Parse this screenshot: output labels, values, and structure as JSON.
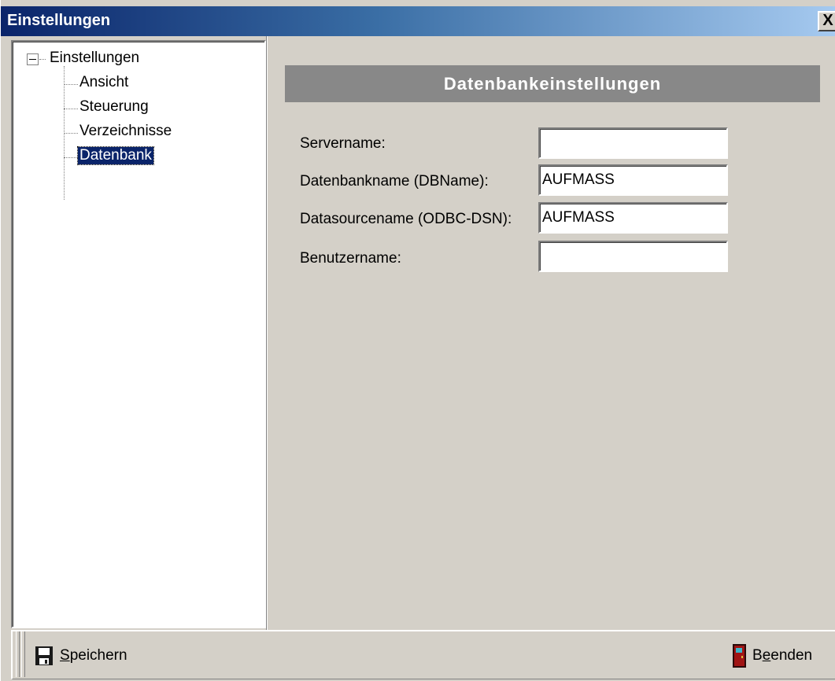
{
  "window": {
    "title": "Einstellungen",
    "close_label": "X"
  },
  "tree": {
    "root_label": "Einstellungen",
    "items": [
      {
        "label": "Ansicht"
      },
      {
        "label": "Steuerung"
      },
      {
        "label": "Verzeichnisse"
      },
      {
        "label": "Datenbank",
        "selected": true
      }
    ]
  },
  "panel": {
    "header": "Datenbankeinstellungen",
    "fields": [
      {
        "label": "Servername:",
        "value": ""
      },
      {
        "label": "Datenbankname (DBName):",
        "value": "AUFMASS"
      },
      {
        "label": "Datasourcename (ODBC-DSN):",
        "value": "AUFMASS"
      },
      {
        "label": "Benutzername:",
        "value": ""
      }
    ]
  },
  "toolbar": {
    "save": {
      "prefix": "",
      "mnemonic": "S",
      "rest": "peichern",
      "icon": "floppy-disk-icon"
    },
    "exit": {
      "prefix": "B",
      "mnemonic": "e",
      "rest": "enden",
      "icon": "door-exit-icon"
    }
  },
  "colors": {
    "titlebar_start": "#0a246a",
    "titlebar_end": "#a6caf0",
    "selection": "#0a246a",
    "header_bar": "#888888",
    "window_bg": "#d4d0c8"
  }
}
